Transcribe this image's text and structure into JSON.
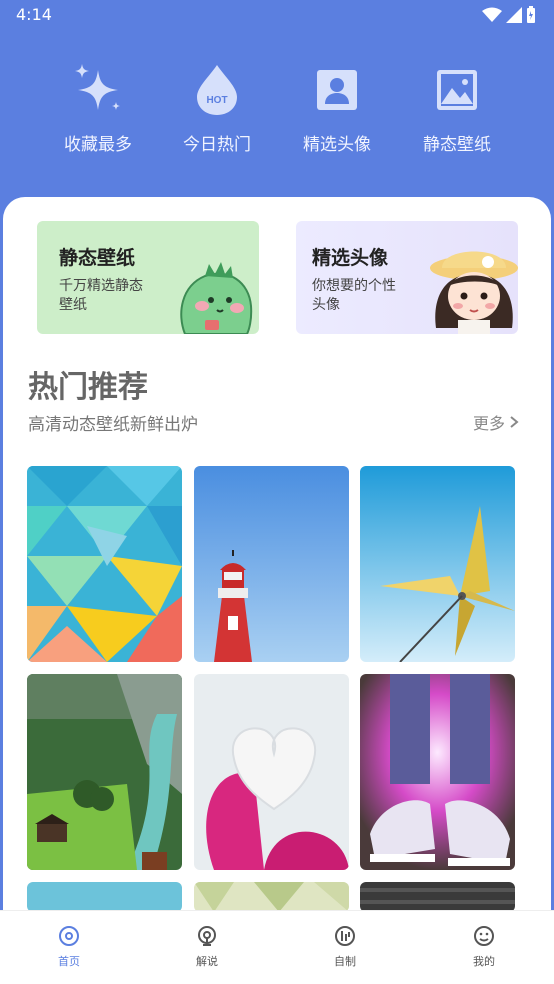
{
  "status": {
    "time": "4:14"
  },
  "quick_entries": [
    {
      "label": "收藏最多",
      "icon": "sparkle-icon"
    },
    {
      "label": "今日热门",
      "icon": "hot-drop-icon",
      "badge": "HOT"
    },
    {
      "label": "精选头像",
      "icon": "avatar-card-icon"
    },
    {
      "label": "静态壁纸",
      "icon": "image-icon"
    }
  ],
  "banners": {
    "left": {
      "title": "静态壁纸",
      "subtitle": "千万精选静态壁纸"
    },
    "right": {
      "title": "精选头像",
      "subtitle": "你想要的个性头像"
    }
  },
  "section": {
    "title": "热门推荐",
    "subtitle": "高清动态壁纸新鲜出炉",
    "more": "更多"
  },
  "bottom_nav": [
    {
      "label": "首页",
      "icon": "home-disc-icon",
      "active": true
    },
    {
      "label": "解说",
      "icon": "commentary-icon",
      "active": false
    },
    {
      "label": "自制",
      "icon": "custom-make-icon",
      "active": false
    },
    {
      "label": "我的",
      "icon": "profile-face-icon",
      "active": false
    }
  ],
  "colors": {
    "header_bg": "#5b7fe0",
    "accent": "#5b7fe0",
    "left_banner": "#cdeec9",
    "right_banner": "#ecebff"
  }
}
